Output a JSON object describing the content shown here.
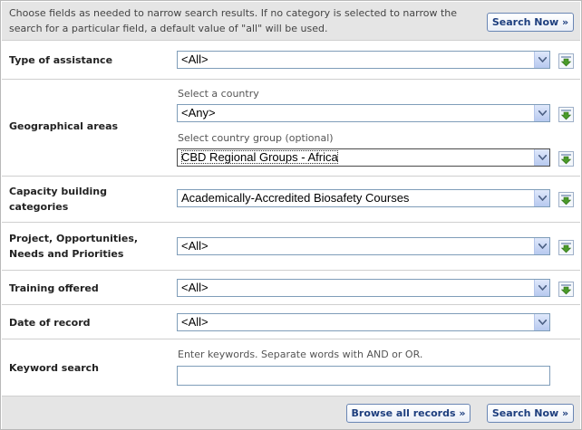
{
  "intro": {
    "line1": "Choose fields as needed to narrow search results. If no category is selected to narrow the",
    "line2": "search for a particular field, a default value of \"all\" will be used."
  },
  "buttons": {
    "search_now": "Search Now »",
    "browse_all": "Browse all records »"
  },
  "fields": {
    "type_of_assistance": {
      "label": "Type of assistance",
      "value": "<All>"
    },
    "geographical_areas": {
      "label": "Geographical areas",
      "country_hint": "Select a country",
      "country_value": "<Any>",
      "group_hint": "Select country group (optional)",
      "group_value": "CBD Regional Groups - Africa"
    },
    "capacity_building": {
      "label_line1": "Capacity building",
      "label_line2": "categories",
      "value": "Academically-Accredited Biosafety Courses"
    },
    "projects": {
      "label_line1": "Project, Opportunities,",
      "label_line2": "Needs and Priorities",
      "value": "<All>"
    },
    "training_offered": {
      "label": "Training offered",
      "value": "<All>"
    },
    "date_of_record": {
      "label": "Date of record",
      "value": "<All>"
    },
    "keyword_search": {
      "label": "Keyword search",
      "hint": "Enter keywords. Separate words with AND or OR.",
      "value": ""
    }
  },
  "icons": {
    "add": "add-selection-icon",
    "dropdown": "chevron-down-icon"
  },
  "colors": {
    "panel_bg": "#e5e5e5",
    "button_text": "#1d3e7e",
    "add_icon_green": "#4a9a2a"
  }
}
